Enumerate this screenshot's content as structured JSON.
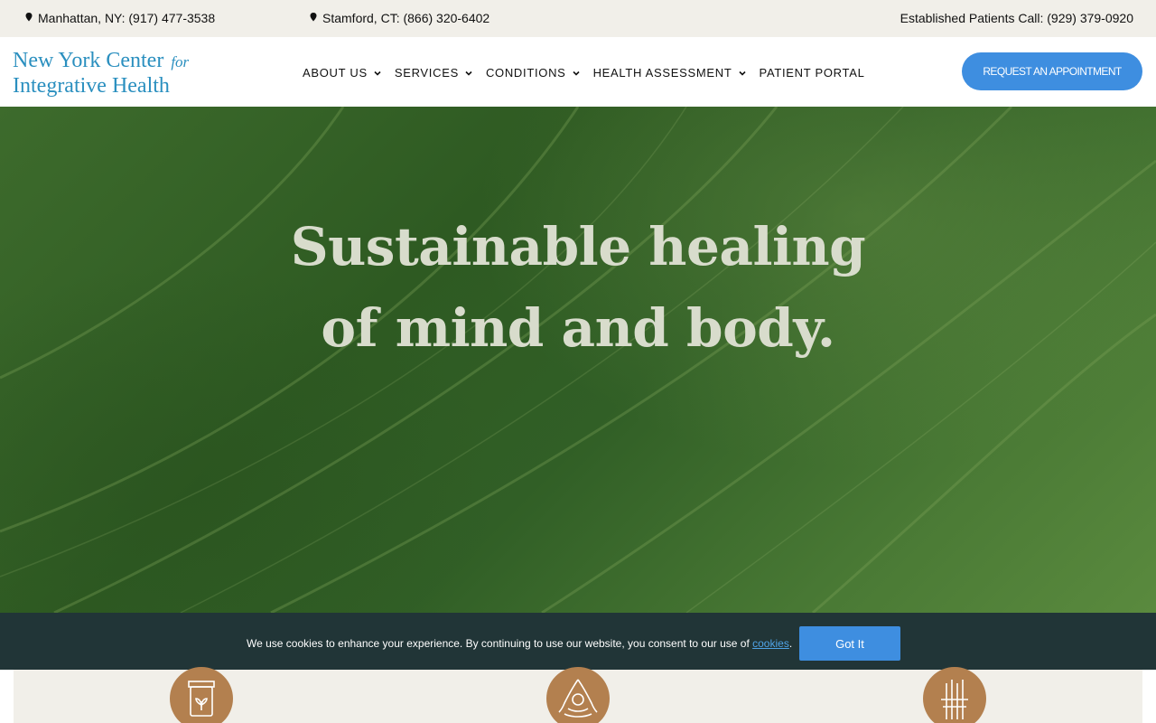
{
  "topbar": {
    "manhattan": "Manhattan, NY: (917) 477-3538",
    "stamford": "Stamford, CT: (866) 320-6402",
    "established": "Established Patients Call: (929) 379-0920"
  },
  "logo": {
    "line1": "New York Center",
    "for": "for",
    "line2": "Integrative Health"
  },
  "nav": {
    "items": [
      {
        "label": "ABOUT US",
        "dropdown": true
      },
      {
        "label": "SERVICES",
        "dropdown": true
      },
      {
        "label": "CONDITIONS",
        "dropdown": true
      },
      {
        "label": "HEALTH ASSESSMENT",
        "dropdown": true
      },
      {
        "label": "PATIENT PORTAL",
        "dropdown": false
      }
    ],
    "cta": "REQUEST AN APPOINTMENT"
  },
  "hero": {
    "line1": "Sustainable healing",
    "line2": "of mind and body."
  },
  "cookie": {
    "text": "We use cookies to enhance your experience. By continuing to use our website, you consent to our use of ",
    "link": "cookies",
    "period": ".",
    "button": "Got It"
  },
  "icons": [
    "herbal-jar-icon",
    "meditation-icon",
    "acupuncture-needles-icon"
  ],
  "colors": {
    "accent": "#3e8ee0",
    "logo": "#2a8fbf",
    "cookie_bg": "#213537",
    "icon_bg": "#b3804f",
    "topbar_bg": "#f1efe9"
  }
}
